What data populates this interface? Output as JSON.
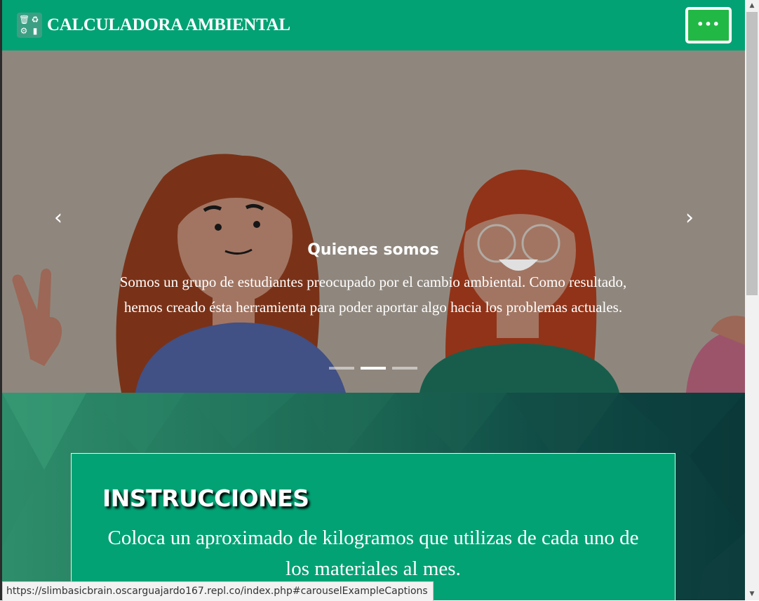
{
  "navbar": {
    "brand": "CALCULADORA AMBIENTAL",
    "menu_label": "•••",
    "logo_icon": "recycling-bins-icon",
    "bg_color": "#02a274"
  },
  "carousel": {
    "prev_icon": "‹",
    "next_icon": "›",
    "caption_title": "Quienes somos",
    "caption_text": "Somos un grupo de estudiantes preocupado por el cambio ambiental. Como resultado, hemos creado ésta herramienta para poder aportar algo hacia los problemas actuales.",
    "indicator_count": 3,
    "active_indicator": 2
  },
  "instructions": {
    "title": "INSTRUCCIONES",
    "text": "Coloca un aproximado de kilogramos que utilizas de cada uno de los materiales al mes."
  },
  "statusbar": {
    "url": "https://slimbasicbrain.oscarguajardo167.repl.co/index.php#carouselExampleCaptions"
  },
  "colors": {
    "accent": "#02a274",
    "menu_button": "#22b845"
  }
}
